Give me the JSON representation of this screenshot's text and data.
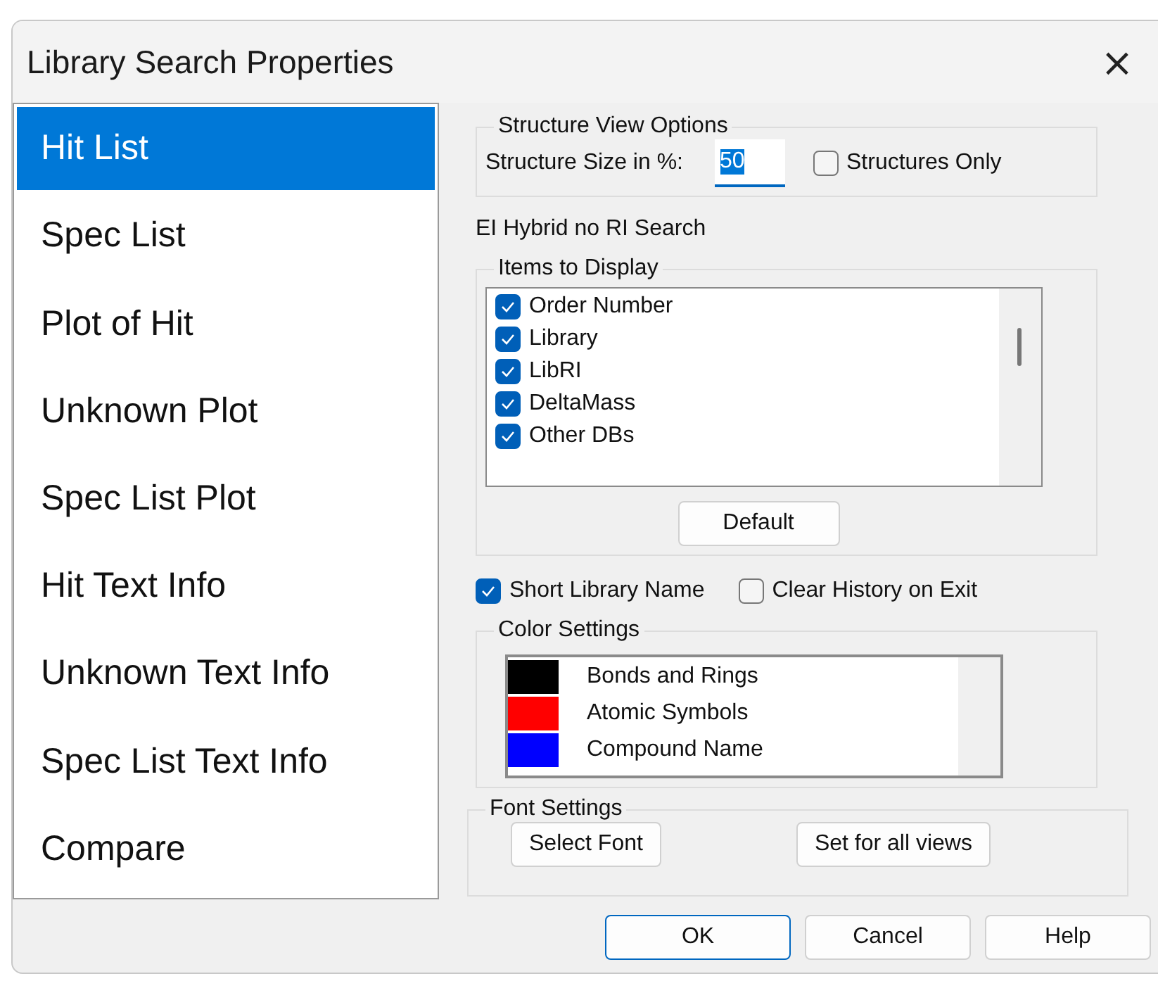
{
  "window": {
    "title": "Library Search Properties",
    "close": "×"
  },
  "nav": [
    {
      "label": "Hit List",
      "selected": true
    },
    {
      "label": "Spec List",
      "selected": false
    },
    {
      "label": "Plot of Hit",
      "selected": false
    },
    {
      "label": "Unknown Plot",
      "selected": false
    },
    {
      "label": "Spec List Plot",
      "selected": false
    },
    {
      "label": "Hit Text Info",
      "selected": false
    },
    {
      "label": "Unknown Text Info",
      "selected": false
    },
    {
      "label": "Spec List Text Info",
      "selected": false
    },
    {
      "label": "Compare",
      "selected": false
    }
  ],
  "structure_view": {
    "title": "Structure View Options",
    "size_label": "Structure Size in %:",
    "size_value": "50",
    "structures_only": {
      "label": "Structures Only",
      "checked": false
    }
  },
  "search_type": "EI Hybrid no RI Search",
  "items_to_display": {
    "title": "Items to Display",
    "items": [
      {
        "label": "Order Number",
        "checked": true
      },
      {
        "label": "Library",
        "checked": true
      },
      {
        "label": "LibRI",
        "checked": true
      },
      {
        "label": "DeltaMass",
        "checked": true
      },
      {
        "label": "Other DBs",
        "checked": true
      }
    ],
    "default_button": "Default"
  },
  "options": [
    {
      "label": "Short Library Name",
      "checked": true
    },
    {
      "label": "Clear History on Exit",
      "checked": false
    }
  ],
  "color_settings": {
    "title": "Color Settings",
    "items": [
      {
        "label": "Bonds and Rings",
        "color": "#000000"
      },
      {
        "label": "Atomic Symbols",
        "color": "#ff0000"
      },
      {
        "label": "Compound Name",
        "color": "#0000ff"
      }
    ]
  },
  "font_settings": {
    "title": "Font Settings",
    "buttons": [
      "Select Font",
      "Set for all views"
    ]
  },
  "buttons": [
    {
      "label": "OK",
      "default": true
    },
    {
      "label": "Cancel",
      "default": false
    },
    {
      "label": "Help",
      "default": false
    }
  ]
}
